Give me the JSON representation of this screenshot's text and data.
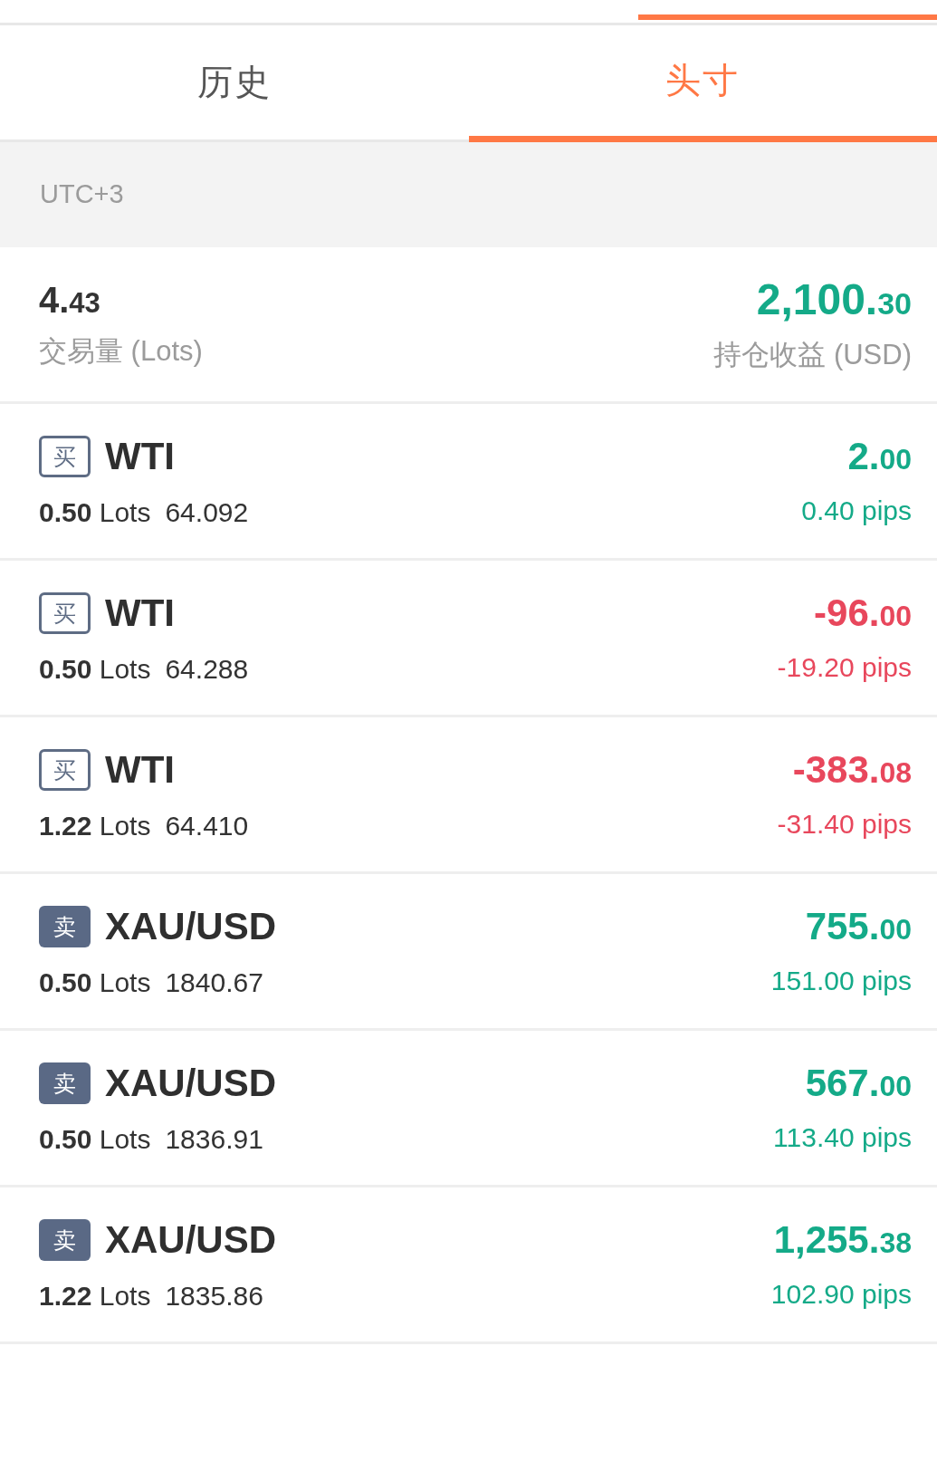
{
  "tabs": [
    {
      "label": "历史",
      "selected": false
    },
    {
      "label": "头寸",
      "selected": true
    }
  ],
  "timezone": "UTC+3",
  "summary": {
    "volume": "4.43",
    "volume_label": "交易量 (Lots)",
    "profit": "2,100.30",
    "profit_label": "持仓收益 (USD)"
  },
  "positions": [
    {
      "kind": "buy",
      "side_label": "买",
      "symbol": "WTI",
      "volume": "**0.50** Lots",
      "price": "64.092",
      "profit": "2.00",
      "pips": "0.40 pips",
      "color": "#14aa88"
    },
    {
      "kind": "buy",
      "side_label": "买",
      "symbol": "WTI",
      "volume": "**0.50** Lots",
      "price": "64.288",
      "profit": "-96.00",
      "pips": "-19.20 pips",
      "color": "#e8475c"
    },
    {
      "kind": "buy",
      "side_label": "买",
      "symbol": "WTI",
      "volume": "**1.22** Lots",
      "price": "64.410",
      "profit": "-383.08",
      "pips": "-31.40 pips",
      "color": "#e8475c"
    },
    {
      "kind": "sell",
      "side_label": "卖",
      "symbol": "XAU/USD",
      "volume": "**0.50** Lots",
      "price": "1840.67",
      "profit": "755.00",
      "pips": "151.00 pips",
      "color": "#14aa88"
    },
    {
      "kind": "sell",
      "side_label": "卖",
      "symbol": "XAU/USD",
      "volume": "**0.50** Lots",
      "price": "1836.91",
      "profit": "567.00",
      "pips": "113.40 pips",
      "color": "#14aa88"
    },
    {
      "kind": "sell",
      "side_label": "卖",
      "symbol": "XAU/USD",
      "volume": "**1.22** Lots",
      "price": "1835.86",
      "profit": "1,255.38",
      "pips": "102.90 pips",
      "color": "#14aa88"
    }
  ]
}
